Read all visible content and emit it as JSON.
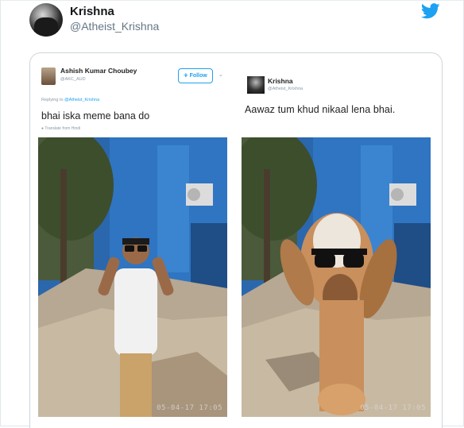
{
  "tweet": {
    "display_name": "Krishna",
    "handle": "@Atheist_Krishna",
    "icons": {
      "avatar": "profile-photo",
      "brand": "twitter-bird-icon"
    },
    "colors": {
      "brand": "#1da1f2"
    }
  },
  "quoted_image": {
    "left_tweet": {
      "name": "Ashish Kumar Choubey",
      "handle": "@AKC_AUD",
      "follow_label": "Follow",
      "replying_prefix": "Replying to",
      "replying_mention": "@Atheist_Krishna",
      "text": "bhai iska meme bana do",
      "translate": "Translate from Hindi",
      "photo_timestamp": "05-04-17 17:05"
    },
    "right_tweet": {
      "name": "Krishna",
      "handle": "@Atheist_Krishna",
      "text": "Aawaz tum khud nikaal lena bhai.",
      "photo_timestamp": "05-04-17 17:05"
    }
  }
}
